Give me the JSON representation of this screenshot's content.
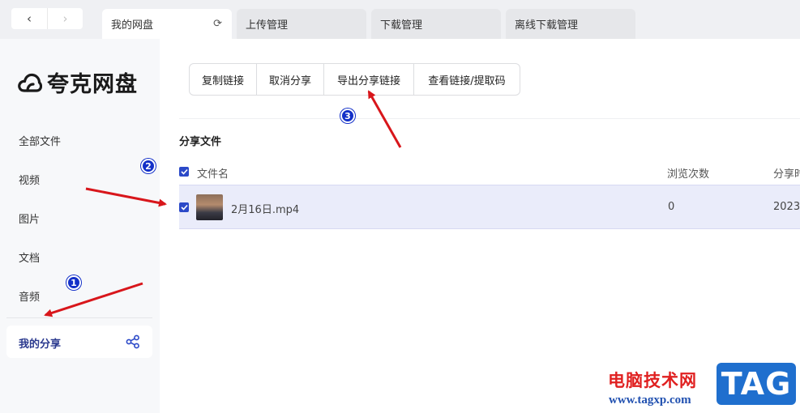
{
  "nav": {
    "back": "‹",
    "forward": "›"
  },
  "tabs": [
    {
      "label": "我的网盘",
      "active": true
    },
    {
      "label": "上传管理",
      "active": false
    },
    {
      "label": "下载管理",
      "active": false
    },
    {
      "label": "离线下载管理",
      "active": false
    }
  ],
  "refresh_glyph": "⟳",
  "brand": {
    "name": "夸克网盘"
  },
  "sidebar": {
    "items": [
      {
        "label": "全部文件"
      },
      {
        "label": "视频"
      },
      {
        "label": "图片"
      },
      {
        "label": "文档"
      },
      {
        "label": "音频"
      }
    ],
    "active_item": {
      "label": "我的分享"
    }
  },
  "toolbar": {
    "buttons": [
      {
        "label": "复制链接"
      },
      {
        "label": "取消分享"
      },
      {
        "label": "导出分享链接"
      },
      {
        "label": "查看链接/提取码"
      }
    ]
  },
  "section": {
    "title": "分享文件"
  },
  "table": {
    "headers": {
      "name": "文件名",
      "views": "浏览次数",
      "share_time": "分享时"
    },
    "rows": [
      {
        "name": "2月16日.mp4",
        "views": "0",
        "share_time": "2023-"
      }
    ]
  },
  "annotations": [
    {
      "number": "1"
    },
    {
      "number": "2"
    },
    {
      "number": "3"
    }
  ],
  "watermark": {
    "site_name": "电脑技术网",
    "url": "www.tagxp.com",
    "badge": "TAG"
  },
  "colors": {
    "accent": "#2b49c8",
    "annotation_arrow": "#d8161b",
    "annotation_marker": "#1330c8",
    "row_selected": "#eaecfa"
  }
}
